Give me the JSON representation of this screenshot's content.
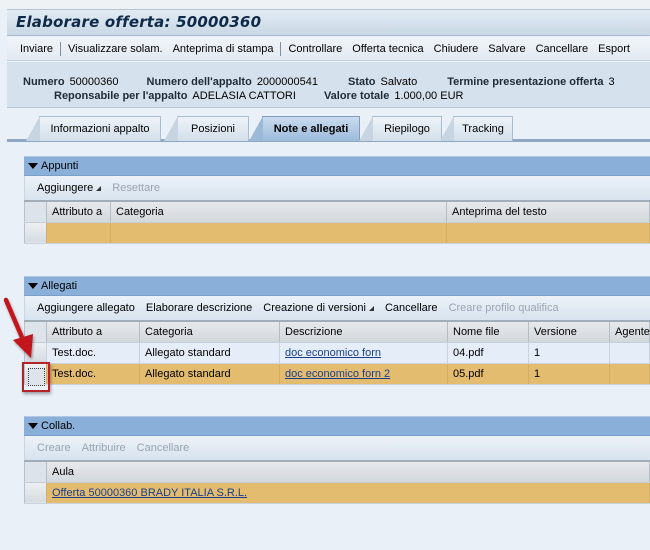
{
  "header": {
    "title": "Elaborare offerta: 50000360"
  },
  "toolbar": {
    "items": [
      {
        "label": "Inviare",
        "separator_after": true
      },
      {
        "label": "Visualizzare solam.",
        "separator_after": false
      },
      {
        "label": "Anteprima di stampa",
        "separator_after": true
      },
      {
        "label": "Controllare",
        "separator_after": false
      },
      {
        "label": "Offerta tecnica",
        "separator_after": false
      },
      {
        "label": "Chiudere",
        "separator_after": false
      },
      {
        "label": "Salvare",
        "separator_after": false
      },
      {
        "label": "Cancellare",
        "separator_after": false
      },
      {
        "label": "Esport",
        "separator_after": false
      }
    ]
  },
  "info": {
    "numero_label": "Numero",
    "numero_value": "50000360",
    "appalto_label": "Numero dell'appalto",
    "appalto_value": "2000000541",
    "stato_label": "Stato",
    "stato_value": "Salvato",
    "termine_label": "Termine presentazione offerta",
    "termine_value": "3",
    "responsabile_label": "Reponsabile per l'appalto",
    "responsabile_value": "ADELASIA CATTORI",
    "valore_label": "Valore totale",
    "valore_value": "1.000,00 EUR"
  },
  "tabs": [
    {
      "label": "Informazioni appalto",
      "active": false
    },
    {
      "label": "Posizioni",
      "active": false
    },
    {
      "label": "Note e allegati",
      "active": true
    },
    {
      "label": "Riepilogo",
      "active": false
    },
    {
      "label": "Tracking",
      "active": false
    }
  ],
  "appunti": {
    "title": "Appunti",
    "buttons": [
      {
        "label": "Aggiungere",
        "dropdown": true,
        "disabled": false
      },
      {
        "label": "Resettare",
        "dropdown": false,
        "disabled": true
      }
    ],
    "columns": [
      "Attributo a",
      "Categoria",
      "Anteprima del testo"
    ],
    "rows": [
      {
        "attributo": "",
        "categoria": "",
        "anteprima": "",
        "selected": true
      }
    ]
  },
  "allegati": {
    "title": "Allegati",
    "buttons": [
      {
        "label": "Aggiungere allegato",
        "dropdown": false,
        "disabled": false
      },
      {
        "label": "Elaborare descrizione",
        "dropdown": false,
        "disabled": false
      },
      {
        "label": "Creazione di versioni",
        "dropdown": true,
        "disabled": false
      },
      {
        "label": "Cancellare",
        "dropdown": false,
        "disabled": false
      },
      {
        "label": "Creare profilo qualifica",
        "dropdown": false,
        "disabled": true
      }
    ],
    "columns": [
      "Attributo a",
      "Categoria",
      "Descrizione",
      "Nome file",
      "Versione",
      "Agente"
    ],
    "rows": [
      {
        "attributo": "Test.doc.",
        "categoria": "Allegato standard",
        "descrizione": "doc economico forn",
        "nome_file": "04.pdf",
        "versione": "1",
        "agente": "",
        "selected": false
      },
      {
        "attributo": "Test.doc.",
        "categoria": "Allegato standard",
        "descrizione": "doc economico forn 2",
        "nome_file": "05.pdf",
        "versione": "1",
        "agente": "",
        "selected": true
      }
    ]
  },
  "collab": {
    "title": "Collab.",
    "buttons": [
      {
        "label": "Creare",
        "disabled": true
      },
      {
        "label": "Attribuire",
        "disabled": true
      },
      {
        "label": "Cancellare",
        "disabled": true
      }
    ],
    "columns": [
      "Aula"
    ],
    "rows": [
      {
        "aula": "Offerta 50000360 BRADY ITALIA S.R.L.",
        "selected": true
      }
    ]
  },
  "colors": {
    "section_header": "#8aafd9",
    "selected_row": "#e3bc6f",
    "annotation_red": "#b4232a"
  }
}
